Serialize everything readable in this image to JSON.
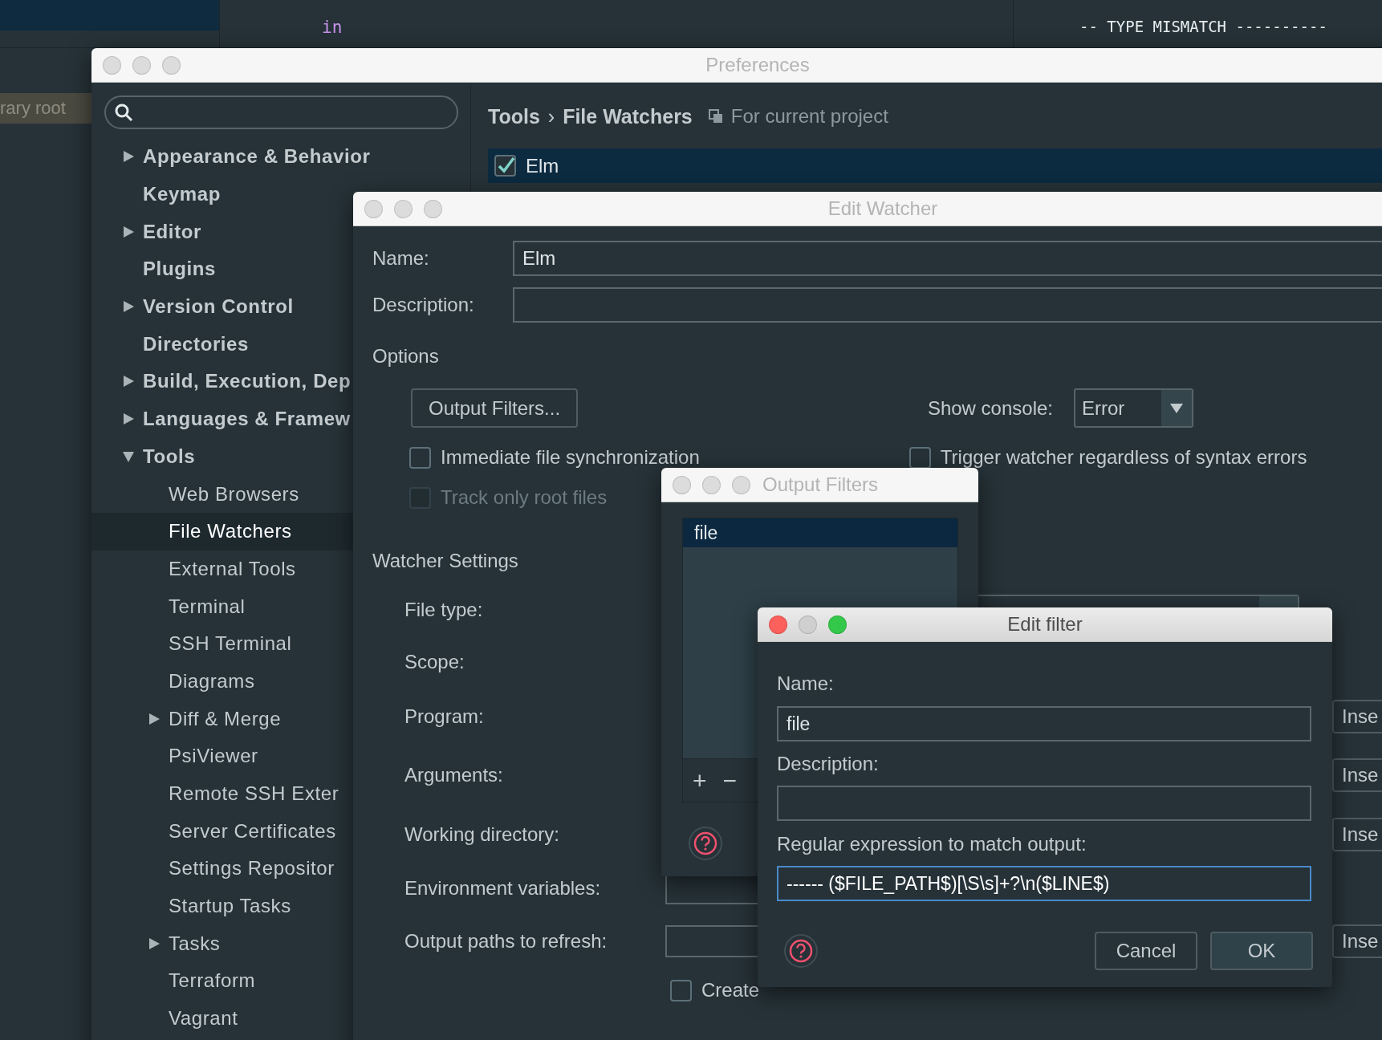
{
  "editor": {
    "code_token": "in",
    "panel_header": "-- TYPE MISMATCH ----------",
    "project_label": "rary root"
  },
  "preferences": {
    "title": "Preferences",
    "tree": [
      {
        "label": "Appearance & Behavior",
        "kind": "group",
        "expanded": false,
        "selected": false
      },
      {
        "label": "Keymap",
        "kind": "leaf",
        "selected": false
      },
      {
        "label": "Editor",
        "kind": "group",
        "expanded": false,
        "selected": false
      },
      {
        "label": "Plugins",
        "kind": "leaf",
        "selected": false
      },
      {
        "label": "Version Control",
        "kind": "group",
        "expanded": false,
        "selected": false
      },
      {
        "label": "Directories",
        "kind": "leaf",
        "selected": false
      },
      {
        "label": "Build, Execution, Dep",
        "kind": "group",
        "expanded": false,
        "selected": false
      },
      {
        "label": "Languages & Framew",
        "kind": "group",
        "expanded": false,
        "selected": false
      },
      {
        "label": "Tools",
        "kind": "group",
        "expanded": true,
        "selected": false,
        "children": [
          {
            "label": "Web Browsers",
            "kind": "leaf",
            "selected": false
          },
          {
            "label": "File Watchers",
            "kind": "leaf",
            "selected": true
          },
          {
            "label": "External Tools",
            "kind": "leaf",
            "selected": false
          },
          {
            "label": "Terminal",
            "kind": "leaf",
            "selected": false
          },
          {
            "label": "SSH Terminal",
            "kind": "leaf",
            "selected": false
          },
          {
            "label": "Diagrams",
            "kind": "leaf",
            "selected": false
          },
          {
            "label": "Diff & Merge",
            "kind": "group",
            "expanded": false,
            "selected": false
          },
          {
            "label": "PsiViewer",
            "kind": "leaf",
            "selected": false
          },
          {
            "label": "Remote SSH Exter",
            "kind": "leaf",
            "selected": false
          },
          {
            "label": "Server Certificates",
            "kind": "leaf",
            "selected": false
          },
          {
            "label": "Settings Repositor",
            "kind": "leaf",
            "selected": false
          },
          {
            "label": "Startup Tasks",
            "kind": "leaf",
            "selected": false
          },
          {
            "label": "Tasks",
            "kind": "group",
            "expanded": false,
            "selected": false
          },
          {
            "label": "Terraform",
            "kind": "leaf",
            "selected": false
          },
          {
            "label": "Vagrant",
            "kind": "leaf",
            "selected": false
          }
        ]
      }
    ],
    "breadcrumb": [
      "Tools",
      "File Watchers"
    ],
    "breadcrumb_separator": "›",
    "scope_label": "For current project",
    "watchers": [
      {
        "name": "Elm",
        "enabled": true,
        "selected": true
      }
    ]
  },
  "edit_watcher": {
    "title": "Edit Watcher",
    "name_label": "Name:",
    "name_value": "Elm",
    "description_label": "Description:",
    "options_heading": "Options",
    "output_filters_button": "Output Filters...",
    "show_console_label": "Show console:",
    "show_console_value": "Error",
    "checkboxes": [
      {
        "label": "Immediate file synchronization",
        "checked": false,
        "disabled": false
      },
      {
        "label": "Track only root files",
        "checked": false,
        "disabled": true
      },
      {
        "label": "Trigger watcher regardless of syntax errors",
        "checked": false,
        "disabled": false
      }
    ],
    "settings_heading": "Watcher Settings",
    "settings": [
      {
        "label": "File type:",
        "kind": "dropdown"
      },
      {
        "label": "Scope:"
      },
      {
        "label": "Program:",
        "insert": "Inse"
      },
      {
        "label": "Arguments:",
        "insert": "Inse"
      },
      {
        "label": "Working directory:",
        "insert": "Inse"
      },
      {
        "label": "Environment variables:",
        "kind": "field"
      },
      {
        "label": "Output paths to refresh:",
        "kind": "field",
        "insert": "Inse"
      }
    ],
    "create_output": {
      "label": "Create",
      "checked": false
    }
  },
  "output_filters": {
    "title": "Output Filters",
    "items": [
      {
        "name": "file",
        "selected": true
      }
    ],
    "add": "+",
    "remove": "−"
  },
  "edit_filter": {
    "title": "Edit filter",
    "name_label": "Name:",
    "name_value": "file",
    "description_label": "Description:",
    "regex_label": "Regular expression to match output:",
    "regex_value": "------ ($FILE_PATH$)[\\S\\s]+?\\n($LINE$)",
    "buttons": [
      {
        "label": "Cancel",
        "default": false
      },
      {
        "label": "OK",
        "default": true
      }
    ]
  }
}
